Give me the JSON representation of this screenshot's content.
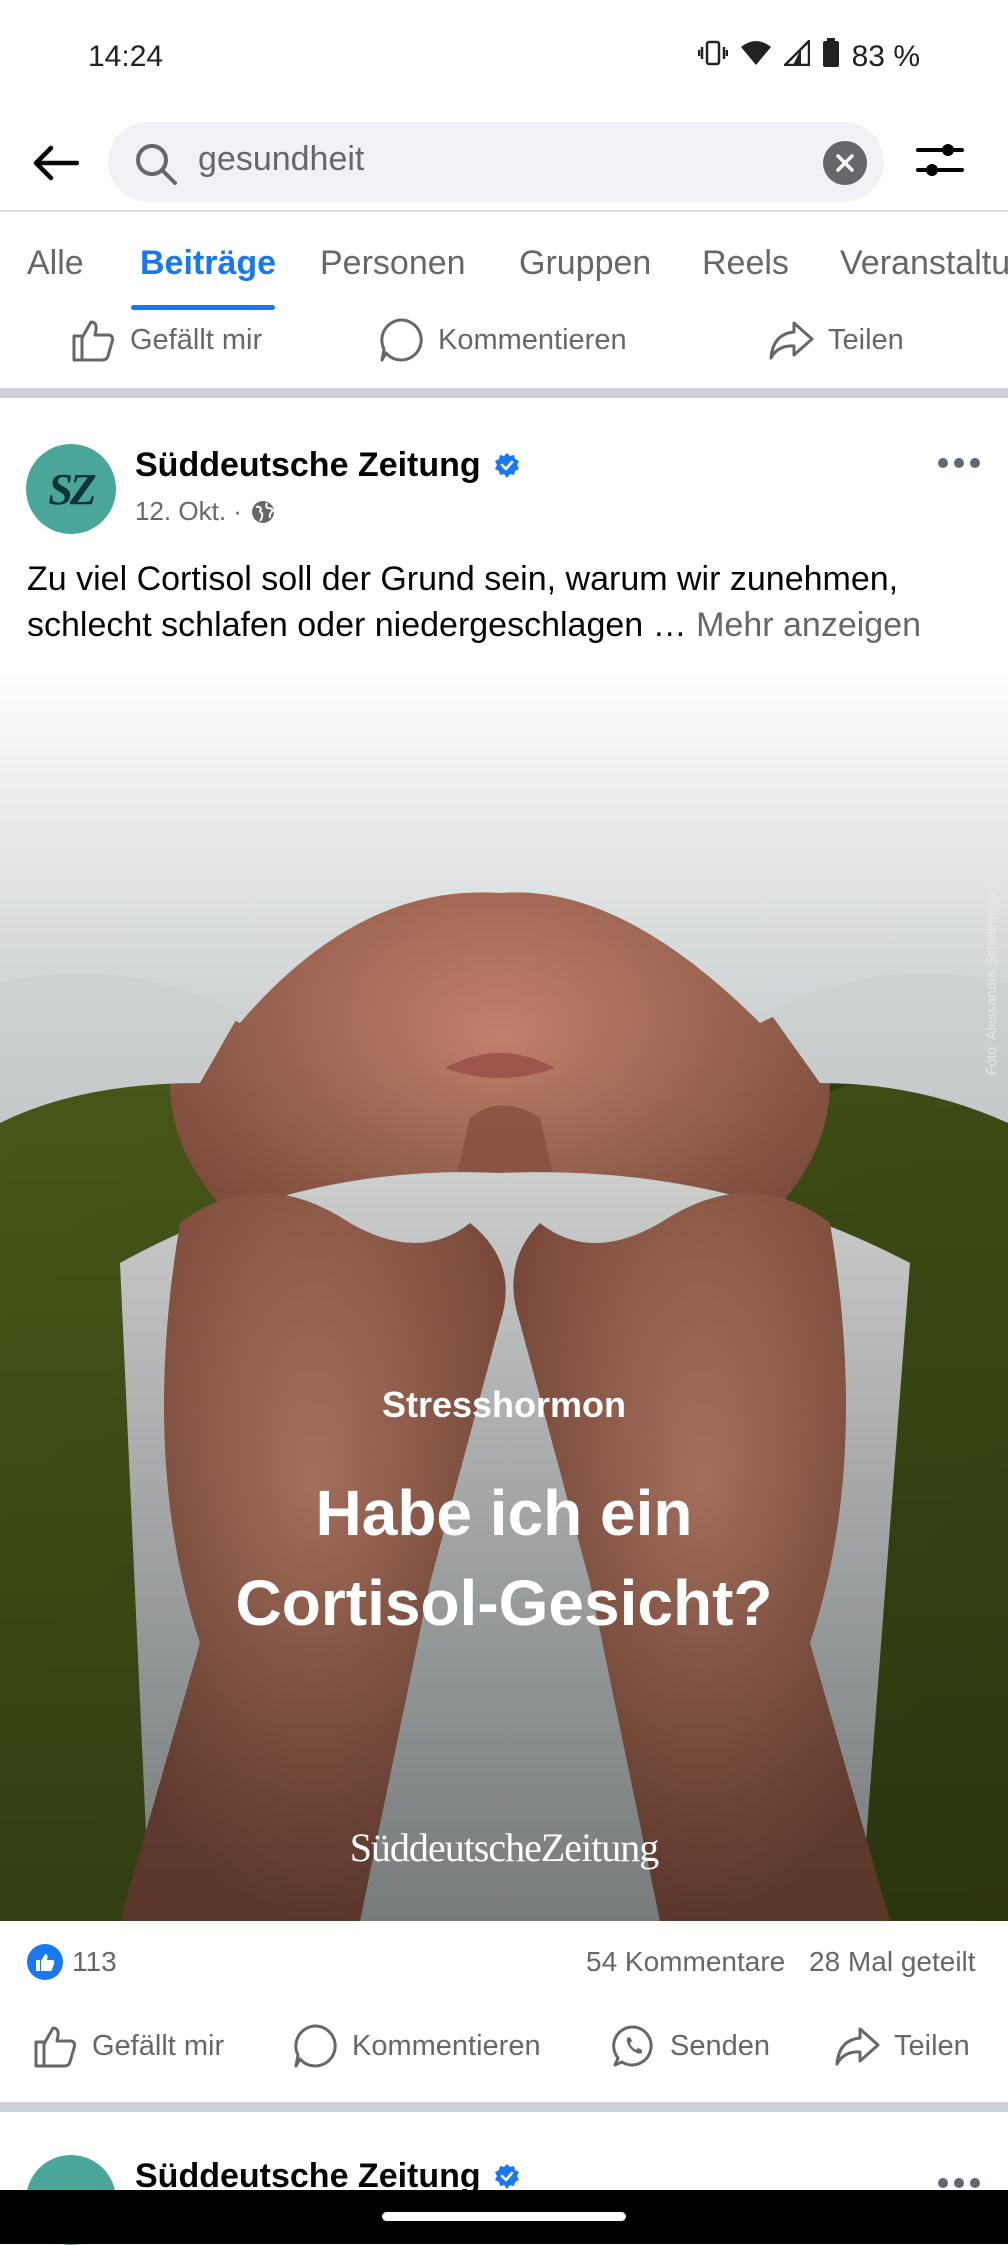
{
  "status_bar": {
    "time": "14:24",
    "battery": "83 %"
  },
  "search": {
    "query": "gesundheit"
  },
  "tabs": [
    {
      "label": "Alle"
    },
    {
      "label": "Beiträge"
    },
    {
      "label": "Personen"
    },
    {
      "label": "Gruppen"
    },
    {
      "label": "Reels"
    },
    {
      "label": "Veranstaltu"
    }
  ],
  "active_tab": "Beiträge",
  "previous_post_actions": {
    "like": "Gefällt mir",
    "comment": "Kommentieren",
    "share": "Teilen"
  },
  "post": {
    "avatar_text": "SZ",
    "author": "Süddeutsche Zeitung",
    "verified": true,
    "date": "12. Okt. ·",
    "audience_icon": "globe-icon",
    "text": "Zu viel Cortisol soll der Grund sein, warum wir zunehmen, schlecht schlafen oder niedergeschlagen …",
    "see_more": "Mehr anzeigen",
    "image": {
      "kicker": "Stresshormon",
      "title": "Habe ich ein Cortisol-Gesicht?",
      "brand": "SüddeutscheZeitung",
      "credit": "Foto: Alessandra Schellnegger"
    },
    "reactions": {
      "likes": "113",
      "comments": "54 Kommentare",
      "shares": "28 Mal geteilt"
    },
    "actions": {
      "like": "Gefällt mir",
      "comment": "Kommentieren",
      "send": "Senden",
      "share": "Teilen"
    }
  },
  "next_post": {
    "author": "Süddeutsche Zeitung"
  },
  "colors": {
    "accent": "#1877f2",
    "secondary_text": "#65676b",
    "avatar_bg": "#4aa59b"
  }
}
